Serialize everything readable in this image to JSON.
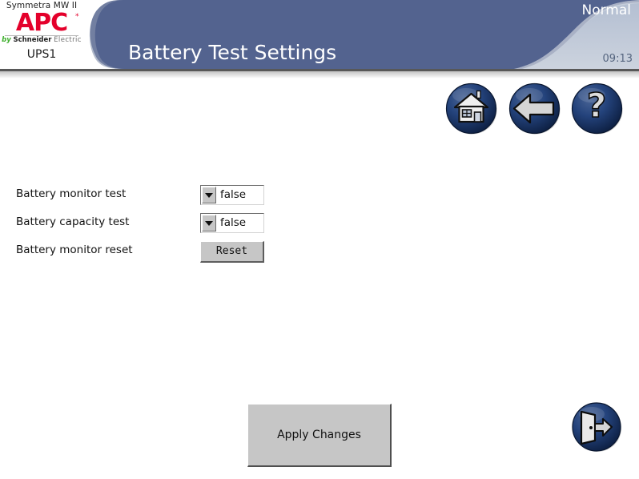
{
  "brand": {
    "model": "Symmetra MW II",
    "logo_text": "APC",
    "trademark": "*",
    "by_label": "by",
    "schneider_label": "Schneider",
    "electric_label": "Electric",
    "unit_name": "UPS1"
  },
  "header": {
    "title": "Battery Test Settings",
    "status": "Normal",
    "time": "09:13",
    "bar_color": "#53638f",
    "status_color": "#ffffff",
    "time_color": "#55657f"
  },
  "nav": {
    "home_label": "Home",
    "back_label": "Back",
    "help_label": "Help",
    "logout_label": "Log Off"
  },
  "form": {
    "rows": [
      {
        "label": "Battery monitor test",
        "control": "dropdown",
        "value": "false"
      },
      {
        "label": "Battery capacity test",
        "control": "dropdown",
        "value": "false"
      },
      {
        "label": "Battery monitor reset",
        "control": "button",
        "value": "Reset"
      }
    ]
  },
  "actions": {
    "apply_label": "Apply Changes"
  }
}
